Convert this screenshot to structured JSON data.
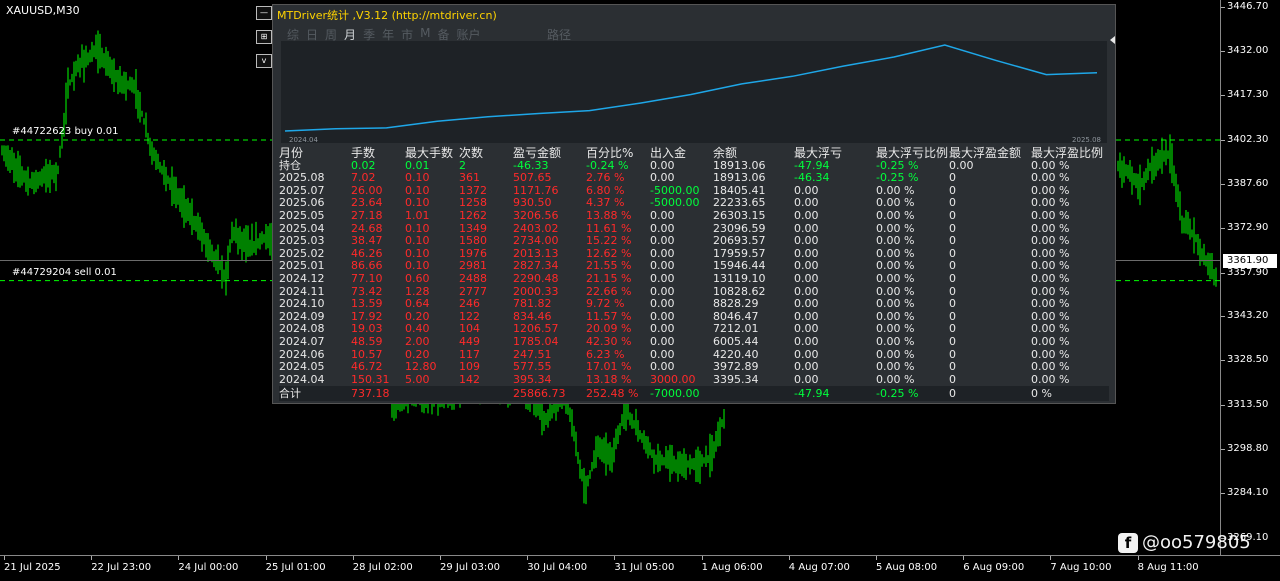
{
  "chart": {
    "symbol": "XAUUSD,M30",
    "orders": [
      {
        "label": "#44722623 buy 0.01",
        "price": 3402.2
      },
      {
        "label": "#44729204 sell 0.01",
        "price": 3355.2
      }
    ],
    "current_price": "3361.90",
    "price_axis": [
      {
        "label": "3446.70",
        "value": 3446.7
      },
      {
        "label": "3432.00",
        "value": 3432.0
      },
      {
        "label": "3417.30",
        "value": 3417.3
      },
      {
        "label": "3402.30",
        "value": 3402.3
      },
      {
        "label": "3387.60",
        "value": 3387.6
      },
      {
        "label": "3372.90",
        "value": 3372.9
      },
      {
        "label": "3357.90",
        "value": 3357.9
      },
      {
        "label": "3343.20",
        "value": 3343.2
      },
      {
        "label": "3328.50",
        "value": 3328.5
      },
      {
        "label": "3313.50",
        "value": 3313.5
      },
      {
        "label": "3298.80",
        "value": 3298.8
      },
      {
        "label": "3284.10",
        "value": 3284.1
      },
      {
        "label": "3269.10",
        "value": 3269.1
      }
    ],
    "time_axis": [
      "21 Jul 2025",
      "22 Jul 23:00",
      "24 Jul 00:00",
      "25 Jul 01:00",
      "28 Jul 02:00",
      "29 Jul 03:00",
      "30 Jul 04:00",
      "31 Jul 05:00",
      "1 Aug 06:00",
      "4 Aug 07:00",
      "5 Aug 08:00",
      "6 Aug 09:00",
      "7 Aug 10:00",
      "8 Aug 11:00"
    ],
    "bar_color": "#00ff00",
    "price_path": [
      [
        0,
        3399
      ],
      [
        30,
        3388
      ],
      [
        58,
        3392
      ],
      [
        68,
        3420
      ],
      [
        80,
        3428
      ],
      [
        98,
        3432
      ],
      [
        118,
        3422
      ],
      [
        135,
        3420
      ],
      [
        152,
        3398
      ],
      [
        175,
        3385
      ],
      [
        200,
        3372
      ],
      [
        226,
        3356
      ],
      [
        232,
        3372
      ],
      [
        250,
        3366
      ],
      [
        265,
        3370
      ],
      [
        272,
        3368
      ],
      [
        392,
        3312
      ],
      [
        420,
        3317
      ],
      [
        450,
        3316
      ],
      [
        486,
        3320
      ],
      [
        524,
        3319
      ],
      [
        545,
        3308
      ],
      [
        565,
        3318
      ],
      [
        585,
        3285
      ],
      [
        598,
        3300
      ],
      [
        612,
        3296
      ],
      [
        625,
        3312
      ],
      [
        638,
        3305
      ],
      [
        655,
        3296
      ],
      [
        680,
        3293
      ],
      [
        700,
        3294
      ],
      [
        712,
        3297
      ],
      [
        722,
        3308
      ],
      [
        1118,
        3394
      ],
      [
        1140,
        3387
      ],
      [
        1150,
        3393
      ],
      [
        1160,
        3396
      ],
      [
        1170,
        3398
      ],
      [
        1182,
        3375
      ],
      [
        1195,
        3370
      ],
      [
        1205,
        3362
      ],
      [
        1216,
        3356
      ]
    ],
    "hidden_range": [
      272,
      1118
    ]
  },
  "watermark": {
    "icon": "f",
    "text": "@oo579805"
  },
  "side_icons": [
    {
      "name": "collapse-icon",
      "glyph": "—"
    },
    {
      "name": "settings-icon",
      "glyph": "⊞"
    },
    {
      "name": "expand-icon",
      "glyph": "v"
    }
  ],
  "panel": {
    "title": "MTDriver统计 ,V3.12 (http://mtdriver.cn)",
    "tabs": [
      "综",
      "日",
      "周",
      "月",
      "季",
      "年",
      "市",
      "M",
      "备",
      "账户"
    ],
    "active_tab": 3,
    "extra_tab": "路径",
    "equity_curve": {
      "x_start": "2024.04",
      "x_end": "2025.08",
      "values": [
        3395.34,
        3972.89,
        4220.4,
        6005.44,
        7212.01,
        8046.47,
        8828.29,
        10828.62,
        13119.1,
        15946.44,
        17959.57,
        20693.57,
        23096.59,
        26303.15,
        22233.65,
        18405.41,
        18913.06
      ],
      "line_color": "#1ea7e8"
    },
    "columns": [
      "月份",
      "手数",
      "最大手数",
      "次数",
      "盈亏金额",
      "百分比%",
      "出入金",
      "余额",
      "最大浮亏",
      "最大浮亏比例",
      "最大浮盈金额",
      "最大浮盈比例"
    ],
    "holding": {
      "month": "持仓",
      "lots": "0.02",
      "maxlot": "0.01",
      "count": "2",
      "pnl": "-46.33",
      "pct": "-0.24 %",
      "io": "0.00",
      "bal": "18913.06",
      "maxfl": "-47.94",
      "maxflp": "-0.25 %",
      "maxfp": "0.00",
      "maxfpp": "0.00 %"
    },
    "rows": [
      {
        "month": "2025.08",
        "lots": "7.02",
        "maxlot": "0.10",
        "count": "361",
        "pnl": "507.65",
        "pct": "2.76 %",
        "io": "0.00",
        "bal": "18913.06",
        "maxfl": "-46.34",
        "maxflp": "-0.25 %",
        "maxfp": "0",
        "maxfpp": "0.00 %"
      },
      {
        "month": "2025.07",
        "lots": "26.00",
        "maxlot": "0.10",
        "count": "1372",
        "pnl": "1171.76",
        "pct": "6.80 %",
        "io": "-5000.00",
        "bal": "18405.41",
        "maxfl": "0.00",
        "maxflp": "0.00 %",
        "maxfp": "0",
        "maxfpp": "0.00 %"
      },
      {
        "month": "2025.06",
        "lots": "23.64",
        "maxlot": "0.10",
        "count": "1258",
        "pnl": "930.50",
        "pct": "4.37 %",
        "io": "-5000.00",
        "bal": "22233.65",
        "maxfl": "0.00",
        "maxflp": "0.00 %",
        "maxfp": "0",
        "maxfpp": "0.00 %"
      },
      {
        "month": "2025.05",
        "lots": "27.18",
        "maxlot": "1.01",
        "count": "1262",
        "pnl": "3206.56",
        "pct": "13.88 %",
        "io": "0.00",
        "bal": "26303.15",
        "maxfl": "0.00",
        "maxflp": "0.00 %",
        "maxfp": "0",
        "maxfpp": "0.00 %"
      },
      {
        "month": "2025.04",
        "lots": "24.68",
        "maxlot": "0.10",
        "count": "1349",
        "pnl": "2403.02",
        "pct": "11.61 %",
        "io": "0.00",
        "bal": "23096.59",
        "maxfl": "0.00",
        "maxflp": "0.00 %",
        "maxfp": "0",
        "maxfpp": "0.00 %"
      },
      {
        "month": "2025.03",
        "lots": "38.47",
        "maxlot": "0.10",
        "count": "1580",
        "pnl": "2734.00",
        "pct": "15.22 %",
        "io": "0.00",
        "bal": "20693.57",
        "maxfl": "0.00",
        "maxflp": "0.00 %",
        "maxfp": "0",
        "maxfpp": "0.00 %"
      },
      {
        "month": "2025.02",
        "lots": "46.26",
        "maxlot": "0.10",
        "count": "1976",
        "pnl": "2013.13",
        "pct": "12.62 %",
        "io": "0.00",
        "bal": "17959.57",
        "maxfl": "0.00",
        "maxflp": "0.00 %",
        "maxfp": "0",
        "maxfpp": "0.00 %"
      },
      {
        "month": "2025.01",
        "lots": "86.66",
        "maxlot": "0.10",
        "count": "2981",
        "pnl": "2827.34",
        "pct": "21.55 %",
        "io": "0.00",
        "bal": "15946.44",
        "maxfl": "0.00",
        "maxflp": "0.00 %",
        "maxfp": "0",
        "maxfpp": "0.00 %"
      },
      {
        "month": "2024.12",
        "lots": "77.10",
        "maxlot": "0.60",
        "count": "2488",
        "pnl": "2290.48",
        "pct": "21.15 %",
        "io": "0.00",
        "bal": "13119.10",
        "maxfl": "0.00",
        "maxflp": "0.00 %",
        "maxfp": "0",
        "maxfpp": "0.00 %"
      },
      {
        "month": "2024.11",
        "lots": "73.42",
        "maxlot": "1.28",
        "count": "2777",
        "pnl": "2000.33",
        "pct": "22.66 %",
        "io": "0.00",
        "bal": "10828.62",
        "maxfl": "0.00",
        "maxflp": "0.00 %",
        "maxfp": "0",
        "maxfpp": "0.00 %"
      },
      {
        "month": "2024.10",
        "lots": "13.59",
        "maxlot": "0.64",
        "count": "246",
        "pnl": "781.82",
        "pct": "9.72 %",
        "io": "0.00",
        "bal": "8828.29",
        "maxfl": "0.00",
        "maxflp": "0.00 %",
        "maxfp": "0",
        "maxfpp": "0.00 %"
      },
      {
        "month": "2024.09",
        "lots": "17.92",
        "maxlot": "0.20",
        "count": "122",
        "pnl": "834.46",
        "pct": "11.57 %",
        "io": "0.00",
        "bal": "8046.47",
        "maxfl": "0.00",
        "maxflp": "0.00 %",
        "maxfp": "0",
        "maxfpp": "0.00 %"
      },
      {
        "month": "2024.08",
        "lots": "19.03",
        "maxlot": "0.40",
        "count": "104",
        "pnl": "1206.57",
        "pct": "20.09 %",
        "io": "0.00",
        "bal": "7212.01",
        "maxfl": "0.00",
        "maxflp": "0.00 %",
        "maxfp": "0",
        "maxfpp": "0.00 %"
      },
      {
        "month": "2024.07",
        "lots": "48.59",
        "maxlot": "2.00",
        "count": "449",
        "pnl": "1785.04",
        "pct": "42.30 %",
        "io": "0.00",
        "bal": "6005.44",
        "maxfl": "0.00",
        "maxflp": "0.00 %",
        "maxfp": "0",
        "maxfpp": "0.00 %"
      },
      {
        "month": "2024.06",
        "lots": "10.57",
        "maxlot": "0.20",
        "count": "117",
        "pnl": "247.51",
        "pct": "6.23 %",
        "io": "0.00",
        "bal": "4220.40",
        "maxfl": "0.00",
        "maxflp": "0.00 %",
        "maxfp": "0",
        "maxfpp": "0.00 %"
      },
      {
        "month": "2024.05",
        "lots": "46.72",
        "maxlot": "12.80",
        "count": "109",
        "pnl": "577.55",
        "pct": "17.01 %",
        "io": "0.00",
        "bal": "3972.89",
        "maxfl": "0.00",
        "maxflp": "0.00 %",
        "maxfp": "0",
        "maxfpp": "0.00 %"
      },
      {
        "month": "2024.04",
        "lots": "150.31",
        "maxlot": "5.00",
        "count": "142",
        "pnl": "395.34",
        "pct": "13.18 %",
        "io": "3000.00",
        "bal": "3395.34",
        "maxfl": "0.00",
        "maxflp": "0.00 %",
        "maxfp": "0",
        "maxfpp": "0.00 %"
      }
    ],
    "total": {
      "month": "合计",
      "lots": "737.18",
      "maxlot": "",
      "count": "",
      "pnl": "25866.73",
      "pct": "252.48 %",
      "io": "-7000.00",
      "bal": "",
      "maxfl": "-47.94",
      "maxflp": "-0.25 %",
      "maxfp": "0",
      "maxfpp": "0 %"
    },
    "colors": {
      "background": "#2b2f33",
      "profit": "#ff2a2a",
      "loss": "#00ff3c",
      "title": "#ffd400"
    }
  }
}
